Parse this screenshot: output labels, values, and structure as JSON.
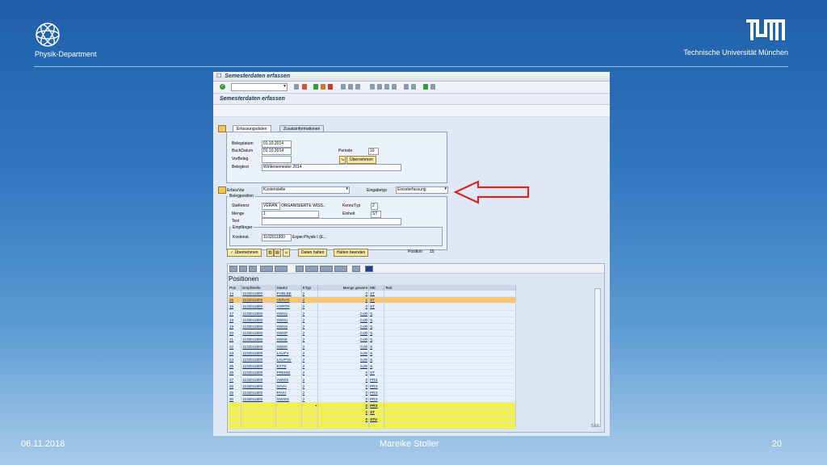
{
  "slide": {
    "department": "Physik-Department",
    "university": "Technische Universität München",
    "footer_date": "06.11.2018",
    "footer_author": "Mareike Stoller",
    "footer_page": "20"
  },
  "sap": {
    "window_title": "Semesterdaten erfassen",
    "screen_title": "Semesterdaten erfassen",
    "tabs": [
      "Erfassungsdaten",
      "Zusatzinformationen"
    ],
    "header": {
      "belegdatum_label": "Belegdatum",
      "belegdatum": "01.10.2014",
      "buchdatum_label": "BuchDatum",
      "buchdatum": "01.10.2014",
      "periode_label": "Periode",
      "periode": "10",
      "vorbeleg_label": "VorBeleg",
      "vorbeleg": "",
      "uebernehmen_label": "Übernehmen",
      "belegtext_label": "Belegtext",
      "belegtext": "Wintersemester 2014"
    },
    "erfassvar_label": "ErfassVar",
    "erfassvar": "Kostenstelle",
    "eingabetyp_label": "Eingabetyp",
    "eingabetyp": "Einzelerfassung",
    "position": {
      "group_title": "Belegposition",
      "stakennz_label": "StaKennz",
      "stakennz": "VERAN",
      "stakennz_text": "ORGANISIERTE WISS..",
      "kennztyp_label": "KennzTyp",
      "kennztyp": "2",
      "menge_label": "Menge",
      "menge": "1",
      "einheit_label": "Einheit",
      "einheit": "ST",
      "text_label": "Text",
      "text": "",
      "empfaenger_title": "Empfänger",
      "kostenst_label": "Kostenst.",
      "kostenst": "1102011800",
      "kostenst_text": "Exper.Physik I (E..."
    },
    "buttons": {
      "uebernehmen": "Übernehmen",
      "daten_halten": "Daten halten",
      "halten_beenden": "Halten beenden"
    },
    "position_label": "Position",
    "position_value": "15",
    "alv_title": "Positionen",
    "columns": [
      "Pos",
      "EmpfStelle",
      "StatKz",
      "KTyp",
      "Menge gesamt",
      "ME",
      "Text"
    ],
    "rows": [
      {
        "pos": "14",
        "empf": "1102011800",
        "statkz": "PUBLBE",
        "ktyp": "2",
        "menge": "0",
        "me": "ST",
        "sel": false
      },
      {
        "pos": "15",
        "empf": "1102011800",
        "statkz": "VERAN",
        "ktyp": "2",
        "menge": "1",
        "me": "ST",
        "sel": true
      },
      {
        "pos": "16",
        "empf": "1102011800",
        "statkz": "VORTR",
        "ktyp": "2",
        "menge": "0",
        "me": "ST",
        "sel": false
      },
      {
        "pos": "17",
        "empf": "1102011800",
        "statkz": "SWSV",
        "ktyp": "2",
        "menge": "0,00",
        "me": "S",
        "sel": false
      },
      {
        "pos": "18",
        "empf": "1102011800",
        "statkz": "SWSU",
        "ktyp": "2",
        "menge": "0,00",
        "me": "S",
        "sel": false
      },
      {
        "pos": "19",
        "empf": "1102011800",
        "statkz": "SWSS",
        "ktyp": "2",
        "menge": "0,00",
        "me": "S",
        "sel": false
      },
      {
        "pos": "20",
        "empf": "1102011800",
        "statkz": "SWSP",
        "ktyp": "2",
        "menge": "0,00",
        "me": "S",
        "sel": false
      },
      {
        "pos": "21",
        "empf": "1102011800",
        "statkz": "SWSE",
        "ktyp": "2",
        "menge": "0,00",
        "me": "S",
        "sel": false
      },
      {
        "pos": "22",
        "empf": "1102011800",
        "statkz": "SWSK",
        "ktyp": "2",
        "menge": "0,00",
        "me": "S",
        "sel": false
      },
      {
        "pos": "23",
        "empf": "1102011800",
        "statkz": "LAUFV",
        "ktyp": "2",
        "menge": "0,00",
        "me": "S",
        "sel": false
      },
      {
        "pos": "24",
        "empf": "1102011800",
        "statkz": "LAUFNV",
        "ktyp": "2",
        "menge": "0,00",
        "me": "S",
        "sel": false
      },
      {
        "pos": "25",
        "empf": "1102011800",
        "statkz": "EXTS",
        "ktyp": "2",
        "menge": "0,00",
        "me": "S",
        "sel": false
      },
      {
        "pos": "26",
        "empf": "1102011800",
        "statkz": "PREISE",
        "ktyp": "2",
        "menge": "0",
        "me": "ST",
        "sel": false
      },
      {
        "pos": "27",
        "empf": "1102011800",
        "statkz": "AWISS",
        "ktyp": "2",
        "menge": "0",
        "me": "PRS",
        "sel": false
      },
      {
        "pos": "28",
        "empf": "1102011800",
        "statkz": "SAVH",
        "ktyp": "2",
        "menge": "0",
        "me": "PRS",
        "sel": false
      },
      {
        "pos": "29",
        "empf": "1102011800",
        "statkz": "PAVH",
        "ktyp": "2",
        "menge": "0",
        "me": "PRS",
        "sel": false
      },
      {
        "pos": "30",
        "empf": "1102011800",
        "statkz": "GWISS",
        "ktyp": "2",
        "menge": "0",
        "me": "PRS",
        "sel": false
      }
    ],
    "totals": [
      {
        "mark": "•",
        "menge": "0",
        "me": "PRS"
      },
      {
        "mark": "",
        "menge": "1",
        "me": "ST"
      },
      {
        "mark": "",
        "menge": "0",
        "me": "STU"
      }
    ],
    "sap_logo": "SAP"
  },
  "colors": {
    "arrow": "#d9252a",
    "selected_row": "#f7c773",
    "total_row": "#f4f04a"
  }
}
